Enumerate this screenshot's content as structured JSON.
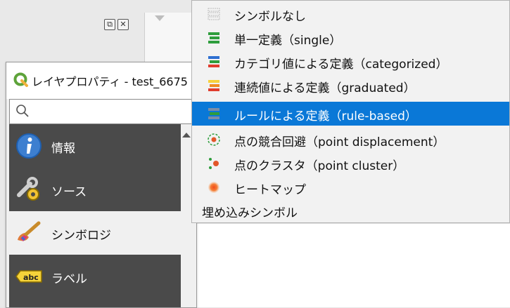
{
  "window": {
    "title": "レイヤプロパティ - test_6675"
  },
  "dock": {
    "buttons": [
      {
        "name": "float",
        "glyph": "⧉"
      },
      {
        "name": "close",
        "glyph": "✕"
      }
    ]
  },
  "search": {
    "value": "",
    "placeholder": ""
  },
  "nav": {
    "items": [
      {
        "label": "情報",
        "icon": "info-icon"
      },
      {
        "label": "ソース",
        "icon": "source-wrench-icon"
      },
      {
        "label": "シンボロジ",
        "icon": "symbology-brush-icon",
        "selected": true
      },
      {
        "label": "ラベル",
        "icon": "abc-label-icon"
      }
    ]
  },
  "menu": {
    "items": [
      {
        "label": "シンボルなし",
        "icon": "no-symbols-icon"
      },
      {
        "label": "単一定義（single）",
        "icon": "single-symbol-icon"
      },
      {
        "label": "カテゴリ値による定義（categorized）",
        "icon": "categorized-icon"
      },
      {
        "label": "連続値による定義（graduated）",
        "icon": "graduated-icon"
      },
      {
        "label": "ルールによる定義（rule-based）",
        "icon": "rule-based-icon",
        "selected": true
      },
      {
        "label": "点の競合回避（point displacement）",
        "icon": "point-displacement-icon"
      },
      {
        "label": "点のクラスタ（point cluster）",
        "icon": "point-cluster-icon"
      },
      {
        "label": "ヒートマップ",
        "icon": "heatmap-icon"
      },
      {
        "label": "埋め込みシンボル",
        "icon": ""
      }
    ]
  },
  "colors": {
    "highlight": "#0a78d7",
    "nav_bg": "#4a4a4a"
  }
}
